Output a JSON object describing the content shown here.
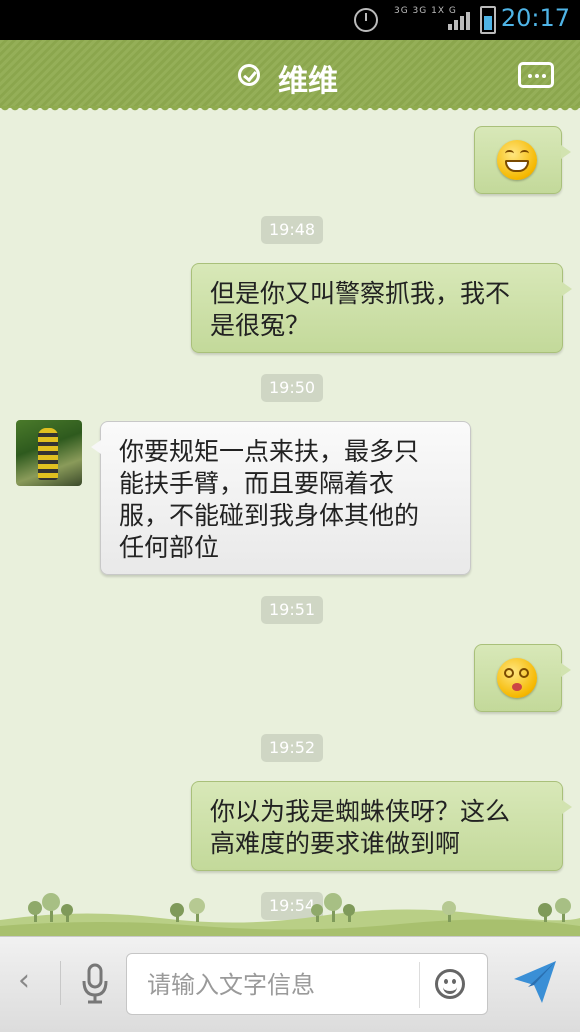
{
  "status_bar": {
    "network_text": "3G 3G 1X G",
    "time": "20:17",
    "icons": [
      "alarm-clock-icon",
      "signal-icon",
      "battery-icon"
    ]
  },
  "header": {
    "title": "维维",
    "online_icon": "check-circle-icon",
    "menu_icon": "more-options-icon"
  },
  "messages": [
    {
      "type": "emoji",
      "side": "out",
      "emoji": "grinning-face-emoji"
    },
    {
      "type": "timestamp",
      "text": "19:48"
    },
    {
      "type": "text",
      "side": "out",
      "lines": [
        "但是你又叫警察抓我，我不",
        "是很冤？"
      ]
    },
    {
      "type": "timestamp",
      "text": "19:50"
    },
    {
      "type": "text",
      "side": "in",
      "lines": [
        "你要规矩一点来扶，最多只",
        "能扶手臂，而且要隔着衣",
        "服，不能碰到我身体其他的",
        "任何部位"
      ]
    },
    {
      "type": "timestamp",
      "text": "19:51"
    },
    {
      "type": "emoji",
      "side": "out",
      "emoji": "dizzy-face-emoji"
    },
    {
      "type": "timestamp",
      "text": "19:52"
    },
    {
      "type": "text",
      "side": "out",
      "lines": [
        "你以为我是蜘蛛侠呀？这么",
        "高难度的要求谁做到啊"
      ]
    },
    {
      "type": "timestamp",
      "text": "19:54"
    }
  ],
  "input_bar": {
    "placeholder": "请输入文字信息",
    "back_glyph": "‹",
    "icons": [
      "back-arrow-icon",
      "microphone-icon",
      "emoji-smile-icon",
      "send-icon"
    ]
  },
  "colors": {
    "header_green": "#8fab4f",
    "chat_background": "#e9f0dc",
    "outgoing_bubble": "#c9dda3",
    "incoming_bubble": "#f2f2f2",
    "time_blue": "#4fb4e6"
  }
}
